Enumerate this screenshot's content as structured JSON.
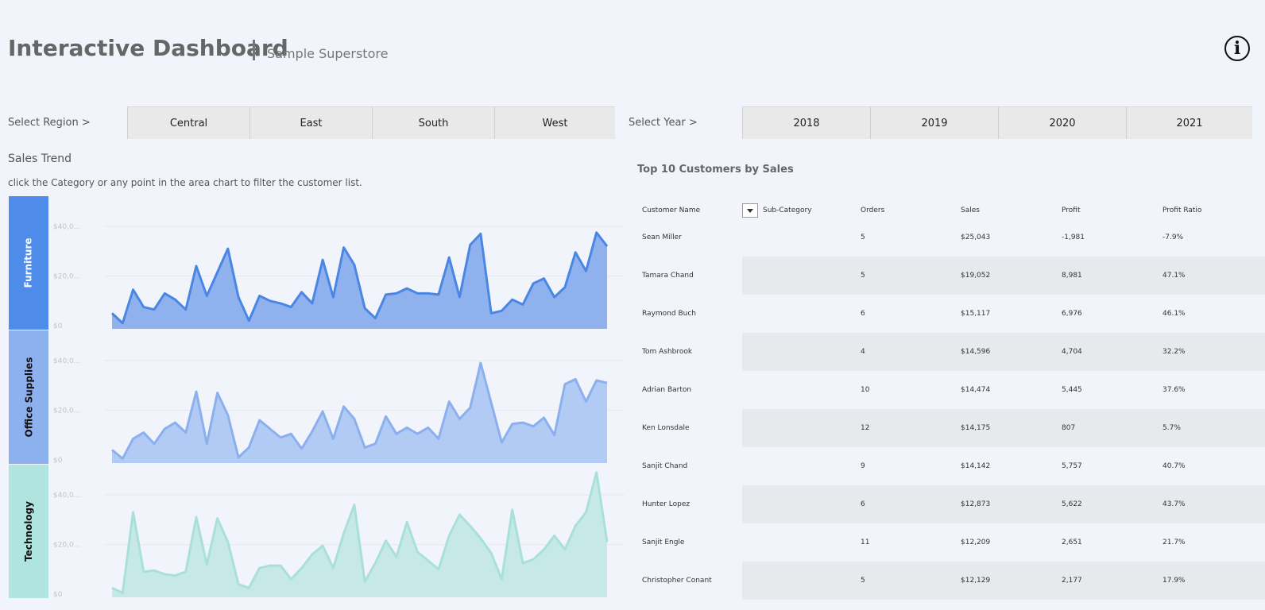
{
  "header": {
    "title": "Interactive Dashboard",
    "subtitle": "Sample Superstore"
  },
  "info_icon": "info-icon",
  "region_filter": {
    "label": "Select Region >",
    "options": [
      "Central",
      "East",
      "South",
      "West"
    ]
  },
  "year_filter": {
    "label": "Select Year >",
    "options": [
      "2018",
      "2019",
      "2020",
      "2021"
    ]
  },
  "sales_trend": {
    "title": "Sales Trend",
    "instruction": "click the Category or any point in the area chart to filter the customer list."
  },
  "colors": {
    "furniture": "#4f8be8",
    "office_supplies": "#8db1ef",
    "technology": "#b0e4df",
    "row_shade": "#e7e9ec",
    "background": "#f1f4fb"
  },
  "chart_data": {
    "type": "area",
    "y_tick_labels": [
      "$0",
      "$20,0...",
      "$40,0..."
    ],
    "ylim": [
      0,
      40000
    ],
    "grid": true,
    "series": [
      {
        "name": "Furniture",
        "values": [
          5000,
          1000,
          14500,
          7500,
          6500,
          13000,
          10500,
          6500,
          24000,
          12000,
          21500,
          31000,
          11500,
          2000,
          12000,
          10000,
          9000,
          7500,
          13500,
          9000,
          26500,
          11500,
          31500,
          24500,
          7000,
          3000,
          12500,
          13000,
          15000,
          13000,
          13000,
          12500,
          27500,
          11500,
          32500,
          37000,
          5000,
          6000,
          10500,
          8500,
          17000,
          19000,
          11500,
          15500,
          29500,
          22000,
          37500,
          32000
        ]
      },
      {
        "name": "Office Supplies",
        "values": [
          4000,
          500,
          8500,
          11000,
          6500,
          12500,
          15000,
          11000,
          27500,
          6500,
          27000,
          18000,
          1000,
          5000,
          16000,
          12500,
          9000,
          10500,
          4500,
          11500,
          19500,
          8500,
          21500,
          16500,
          5000,
          6500,
          17500,
          10500,
          13000,
          10500,
          13000,
          8500,
          23500,
          16500,
          21000,
          39000,
          23000,
          7000,
          14500,
          15000,
          13500,
          17000,
          10000,
          30500,
          32500,
          23500,
          32000,
          31000
        ]
      },
      {
        "name": "Technology",
        "values": [
          2500,
          500,
          33000,
          9000,
          9500,
          8000,
          7500,
          9000,
          31000,
          12000,
          30500,
          21000,
          4000,
          2500,
          10500,
          11500,
          11500,
          6000,
          10500,
          16000,
          19500,
          10500,
          24500,
          36000,
          5000,
          12500,
          21500,
          15000,
          29000,
          17000,
          13500,
          10000,
          23500,
          32000,
          27500,
          22500,
          16500,
          6000,
          34000,
          12500,
          14000,
          18000,
          23500,
          18000,
          27500,
          33000,
          49000,
          21000
        ]
      }
    ]
  },
  "customers_table": {
    "title": "Top 10 Customers by Sales",
    "columns": {
      "customer_name": "Customer Name",
      "sub_category": "Sub-Category",
      "orders": "Orders",
      "sales": "Sales",
      "profit": "Profit",
      "profit_ratio": "Profit Ratio"
    },
    "dropdown_icon": "dropdown-arrow-icon",
    "rows": [
      {
        "name": "Sean Miller",
        "orders": "5",
        "sales": "$25,043",
        "profit": "-1,981",
        "ratio": "-7.9%"
      },
      {
        "name": "Tamara Chand",
        "orders": "5",
        "sales": "$19,052",
        "profit": "8,981",
        "ratio": "47.1%"
      },
      {
        "name": "Raymond Buch",
        "orders": "6",
        "sales": "$15,117",
        "profit": "6,976",
        "ratio": "46.1%"
      },
      {
        "name": "Tom Ashbrook",
        "orders": "4",
        "sales": "$14,596",
        "profit": "4,704",
        "ratio": "32.2%"
      },
      {
        "name": "Adrian Barton",
        "orders": "10",
        "sales": "$14,474",
        "profit": "5,445",
        "ratio": "37.6%"
      },
      {
        "name": "Ken Lonsdale",
        "orders": "12",
        "sales": "$14,175",
        "profit": "807",
        "ratio": "5.7%"
      },
      {
        "name": "Sanjit Chand",
        "orders": "9",
        "sales": "$14,142",
        "profit": "5,757",
        "ratio": "40.7%"
      },
      {
        "name": "Hunter Lopez",
        "orders": "6",
        "sales": "$12,873",
        "profit": "5,622",
        "ratio": "43.7%"
      },
      {
        "name": "Sanjit Engle",
        "orders": "11",
        "sales": "$12,209",
        "profit": "2,651",
        "ratio": "21.7%"
      },
      {
        "name": "Christopher Conant",
        "orders": "5",
        "sales": "$12,129",
        "profit": "2,177",
        "ratio": "17.9%"
      }
    ]
  }
}
